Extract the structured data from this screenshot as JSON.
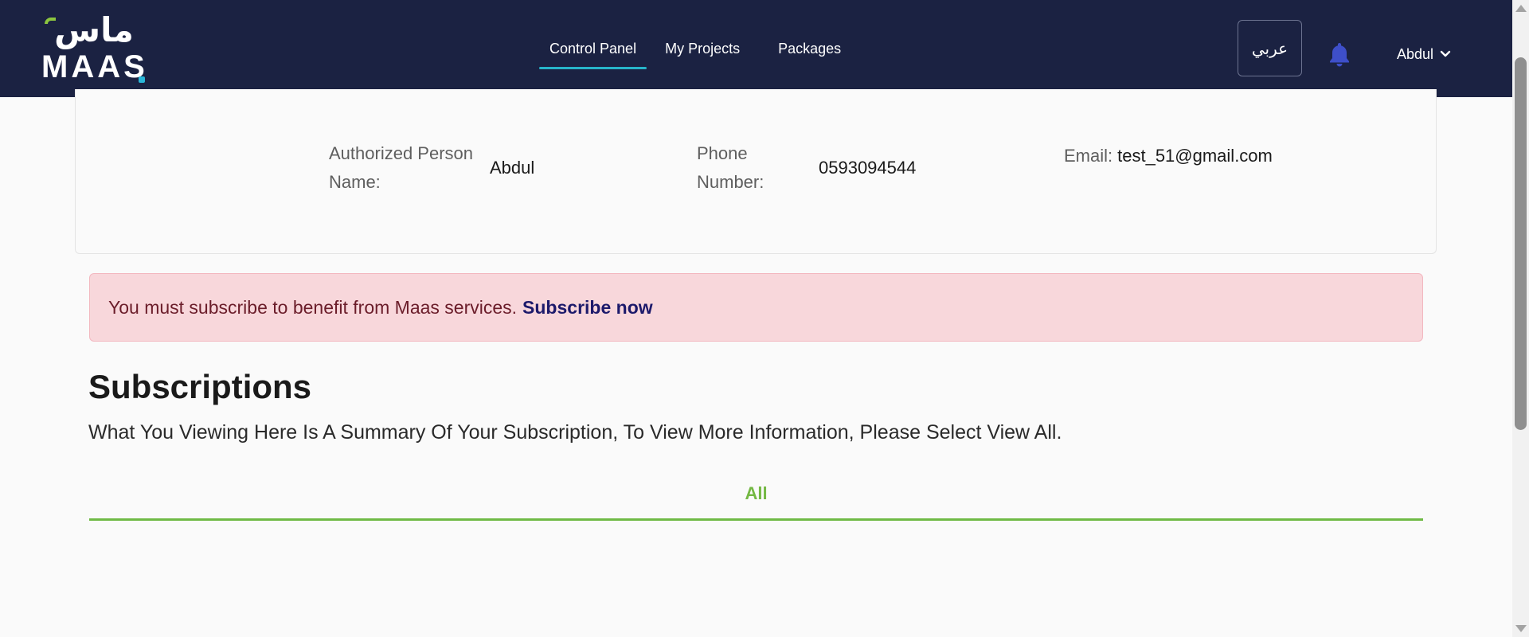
{
  "brand": {
    "logo_arabic": "ماس",
    "logo_latin": "MAAS"
  },
  "nav": {
    "items": [
      {
        "label": "Control Panel",
        "active": true
      },
      {
        "label": "My Projects",
        "active": false
      },
      {
        "label": "Packages",
        "active": false
      }
    ]
  },
  "header": {
    "language_button": "عربي",
    "bell_icon": "bell-icon",
    "user_name": "Abdul",
    "user_menu_icon": "chevron-down-icon"
  },
  "profile": {
    "authorized_person_label": "Authorized Person Name:",
    "authorized_person_value": "Abdul",
    "phone_label": "Phone Number:",
    "phone_value": "0593094544",
    "email_label": "Email:",
    "email_value": "test_51@gmail.com"
  },
  "alert": {
    "message": "You must subscribe to benefit from Maas services.",
    "link": "Subscribe now"
  },
  "subscriptions": {
    "title": "Subscriptions",
    "description": "What You Viewing Here Is A Summary Of Your Subscription, To View More Information, Please Select View All.",
    "tabs": [
      {
        "label": "All",
        "active": true
      }
    ]
  },
  "colors": {
    "header_bg": "#1b2242",
    "nav_active_underline": "#27b4c9",
    "bell": "#3e4fc9",
    "alert_bg": "#f8d7db",
    "alert_link": "#1d1a6b",
    "tab_active": "#74b843"
  }
}
